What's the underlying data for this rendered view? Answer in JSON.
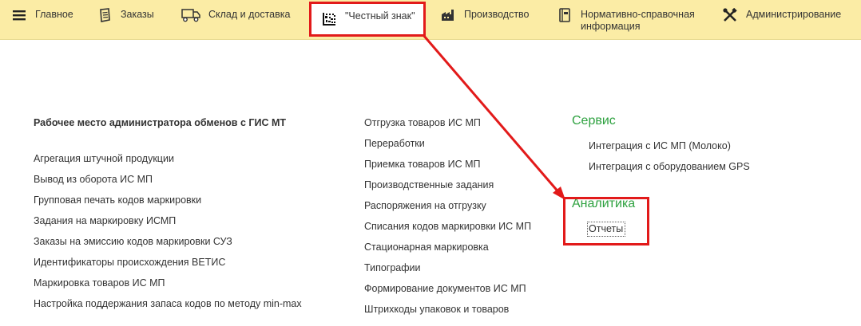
{
  "tabs": [
    {
      "label": "Главное",
      "icon": "menu-icon"
    },
    {
      "label": "Заказы",
      "icon": "orders-icon"
    },
    {
      "label": "Склад и доставка",
      "icon": "truck-icon"
    },
    {
      "label": "\"Честный знак\"",
      "icon": "datamatrix-icon"
    },
    {
      "label": "Производство",
      "icon": "factory-icon"
    },
    {
      "label": "Нормативно-справочная\nинформация",
      "icon": "reference-book-icon"
    },
    {
      "label": "Администрирование",
      "icon": "tools-icon"
    }
  ],
  "column1": {
    "title": "Рабочее место администратора обменов с ГИС МТ",
    "items": [
      "Агрегация штучной продукции",
      "Вывод из оборота ИС МП",
      "Групповая печать кодов маркировки",
      "Задания на маркировку ИСМП",
      "Заказы на эмиссию кодов маркировки СУЗ",
      "Идентификаторы происхождения ВЕТИС",
      "Маркировка товаров ИС МП",
      "Настройка поддержания запаса кодов по методу min-max"
    ]
  },
  "column2": {
    "items": [
      "Отгрузка товаров ИС МП",
      "Переработки",
      "Приемка товаров ИС МП",
      "Производственные задания",
      "Распоряжения на отгрузку",
      "Списания кодов маркировки ИС МП",
      "Стационарная маркировка",
      "Типографии",
      "Формирование документов ИС МП",
      "Штрихкоды упаковок и товаров"
    ]
  },
  "service": {
    "title": "Сервис",
    "items": [
      "Интеграция с ИС МП (Молоко)",
      "Интеграция с оборудованием GPS"
    ]
  },
  "analytics": {
    "title": "Аналитика",
    "items": [
      "Отчеты"
    ]
  },
  "colors": {
    "accent": "#2da13f",
    "highlight": "#e21a1a",
    "topbar": "#fbeca5"
  }
}
